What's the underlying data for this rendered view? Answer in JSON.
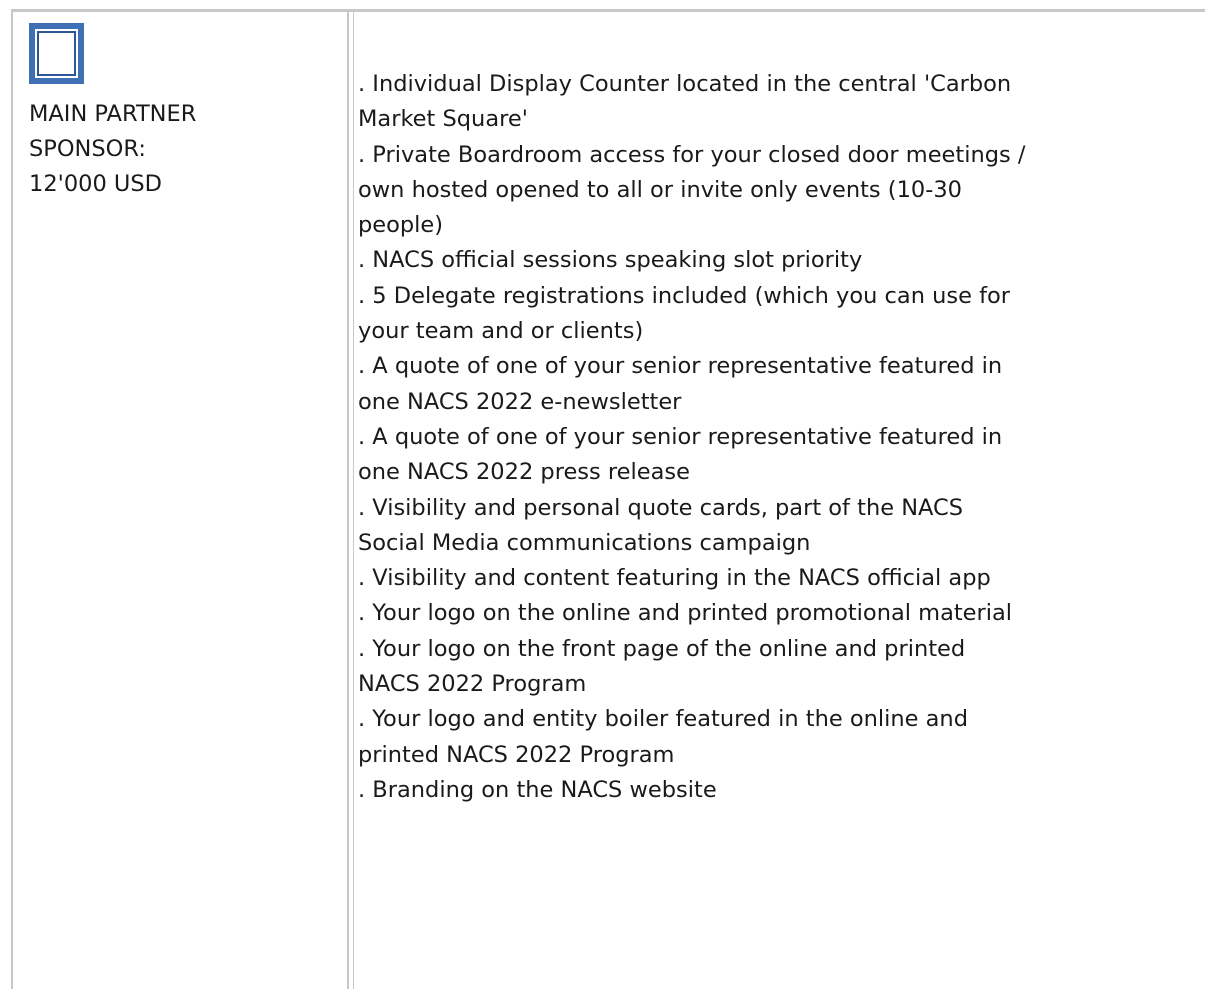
{
  "sponsor": {
    "tier_lines": [
      "MAIN PARTNER",
      "SPONSOR:",
      "12'000 USD"
    ],
    "checkbox_icon": "checkbox-empty-icon",
    "accent_color": "#3f6fb5"
  },
  "benefits": [
    ". Individual Display Counter located in the central 'Carbon",
    "Market Square'",
    ". Private Boardroom access for your closed door meetings /",
    "own hosted opened to all or invite only events (10-30",
    "people)",
    ". NACS official sessions speaking slot priority",
    ". 5 Delegate registrations included (which you can use for",
    "your team and or clients)",
    ". A quote of one of your senior representative featured in",
    "one NACS 2022 e-newsletter",
    ". A quote of one of your senior representative featured in",
    "one NACS 2022 press release",
    ". Visibility and personal quote cards, part of the NACS",
    "Social Media communications campaign",
    ". Visibility and content featuring in the NACS official app",
    ". Your logo on the online and printed promotional material",
    ". Your logo on the front page of the online and printed",
    "NACS 2022 Program",
    ". Your logo and entity boiler featured in the online and",
    "printed NACS 2022 Program",
    ". Branding on the NACS website"
  ]
}
